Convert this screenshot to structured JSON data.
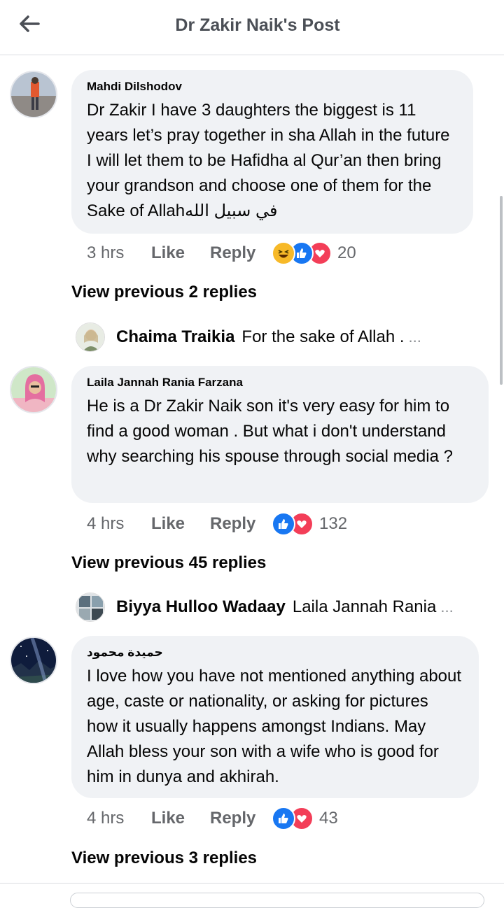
{
  "header": {
    "title": "Dr Zakir Naik's Post",
    "back_icon": "arrow-left-icon"
  },
  "comments": [
    {
      "author": "Mahdi Dilshodov",
      "text": "Dr Zakir I have 3 daughters the biggest is 11 years let’s pray together in sha Allah in the future I will let them to be Hafidha al Qur’an then bring your grandson and choose one of them for the Sake of Allahفي سبيل الله",
      "time": "3 hrs",
      "like_label": "Like",
      "reply_label": "Reply",
      "reactions": [
        "haha",
        "like",
        "love"
      ],
      "reaction_count": "20",
      "view_previous": "View previous 2 replies",
      "latest_reply": {
        "author": "Chaima Traikia",
        "text": "For the sake of Allah .",
        "ellipsis": "..."
      }
    },
    {
      "author": "Laila Jannah Rania Farzana",
      "text": "He is a Dr Zakir Naik son it's very easy for him to find a good woman . But what i don't understand why searching his spouse through social media  ?",
      "time": "4 hrs",
      "like_label": "Like",
      "reply_label": "Reply",
      "reactions": [
        "like",
        "love"
      ],
      "reaction_count": "132",
      "view_previous": "View previous 45 replies",
      "latest_reply": {
        "author": "Biyya Hulloo Wadaay",
        "text": "Laila Jannah Rania",
        "ellipsis": "..."
      }
    },
    {
      "author": "حميدة محمود",
      "text": "I love how you have not mentioned anything about age, caste or nationality, or asking for pictures how it usually happens amongst Indians. May Allah bless your son with a wife who is good for him in dunya and akhirah.",
      "time": "4 hrs",
      "like_label": "Like",
      "reply_label": "Reply",
      "reactions": [
        "like",
        "love"
      ],
      "reaction_count": "43",
      "view_previous": "View previous 3 replies"
    }
  ],
  "colors": {
    "like_blue": "#1877f2",
    "love_red": "#f33e58",
    "haha_yellow": "#f7b928",
    "bubble_gray": "#f0f2f5"
  }
}
